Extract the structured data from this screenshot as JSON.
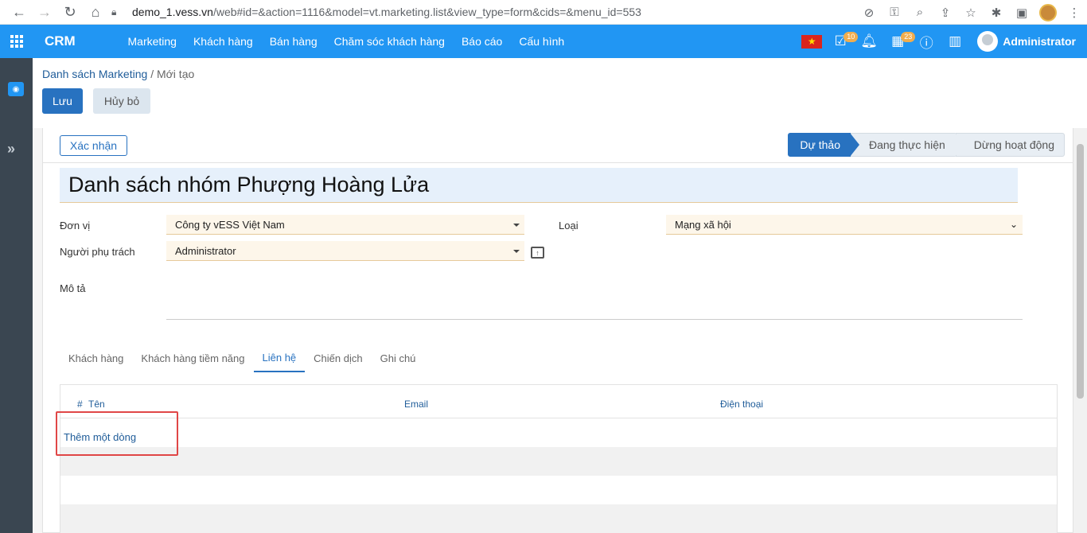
{
  "browser": {
    "url_host": "demo_1.vess.vn",
    "url_path": "/web#id=&action=1116&model=vt.marketing.list&view_type=form&cids=&menu_id=553"
  },
  "app": {
    "brand": "CRM",
    "menu": [
      "Marketing",
      "Khách hàng",
      "Bán hàng",
      "Chăm sóc khách hàng",
      "Báo cáo",
      "Cấu hình"
    ],
    "activity_count": "10",
    "calendar_count": "23",
    "user_name": "Administrator"
  },
  "breadcrumb": {
    "parent": "Danh sách Marketing",
    "separator": "/",
    "current": "Mới tạo"
  },
  "actions": {
    "save": "Lưu",
    "cancel": "Hủy bỏ"
  },
  "statusbar": {
    "confirm": "Xác nhận",
    "stages": [
      "Dự thảo",
      "Đang thực hiện",
      "Dừng hoạt động"
    ],
    "active_stage": "Dự thảo"
  },
  "form": {
    "title": "Danh sách nhóm Phượng Hoàng Lửa",
    "unit_label": "Đơn vị",
    "unit_value": "Công ty vESS Việt Nam",
    "type_label": "Loại",
    "type_value": "Mạng xã hội",
    "owner_label": "Người phụ trách",
    "owner_value": "Administrator",
    "desc_label": "Mô tả"
  },
  "tabs": [
    "Khách hàng",
    "Khách hàng tiềm năng",
    "Liên hệ",
    "Chiến dịch",
    "Ghi chú"
  ],
  "active_tab": "Liên hệ",
  "table": {
    "columns": [
      "#",
      "Tên",
      "Email",
      "Điện thoại"
    ],
    "add_row": "Thêm một dòng"
  },
  "colors": {
    "topbar": "#2196f3",
    "primary_button": "#2872c0",
    "sidebar": "#3a4651",
    "highlight": "#e04646"
  }
}
